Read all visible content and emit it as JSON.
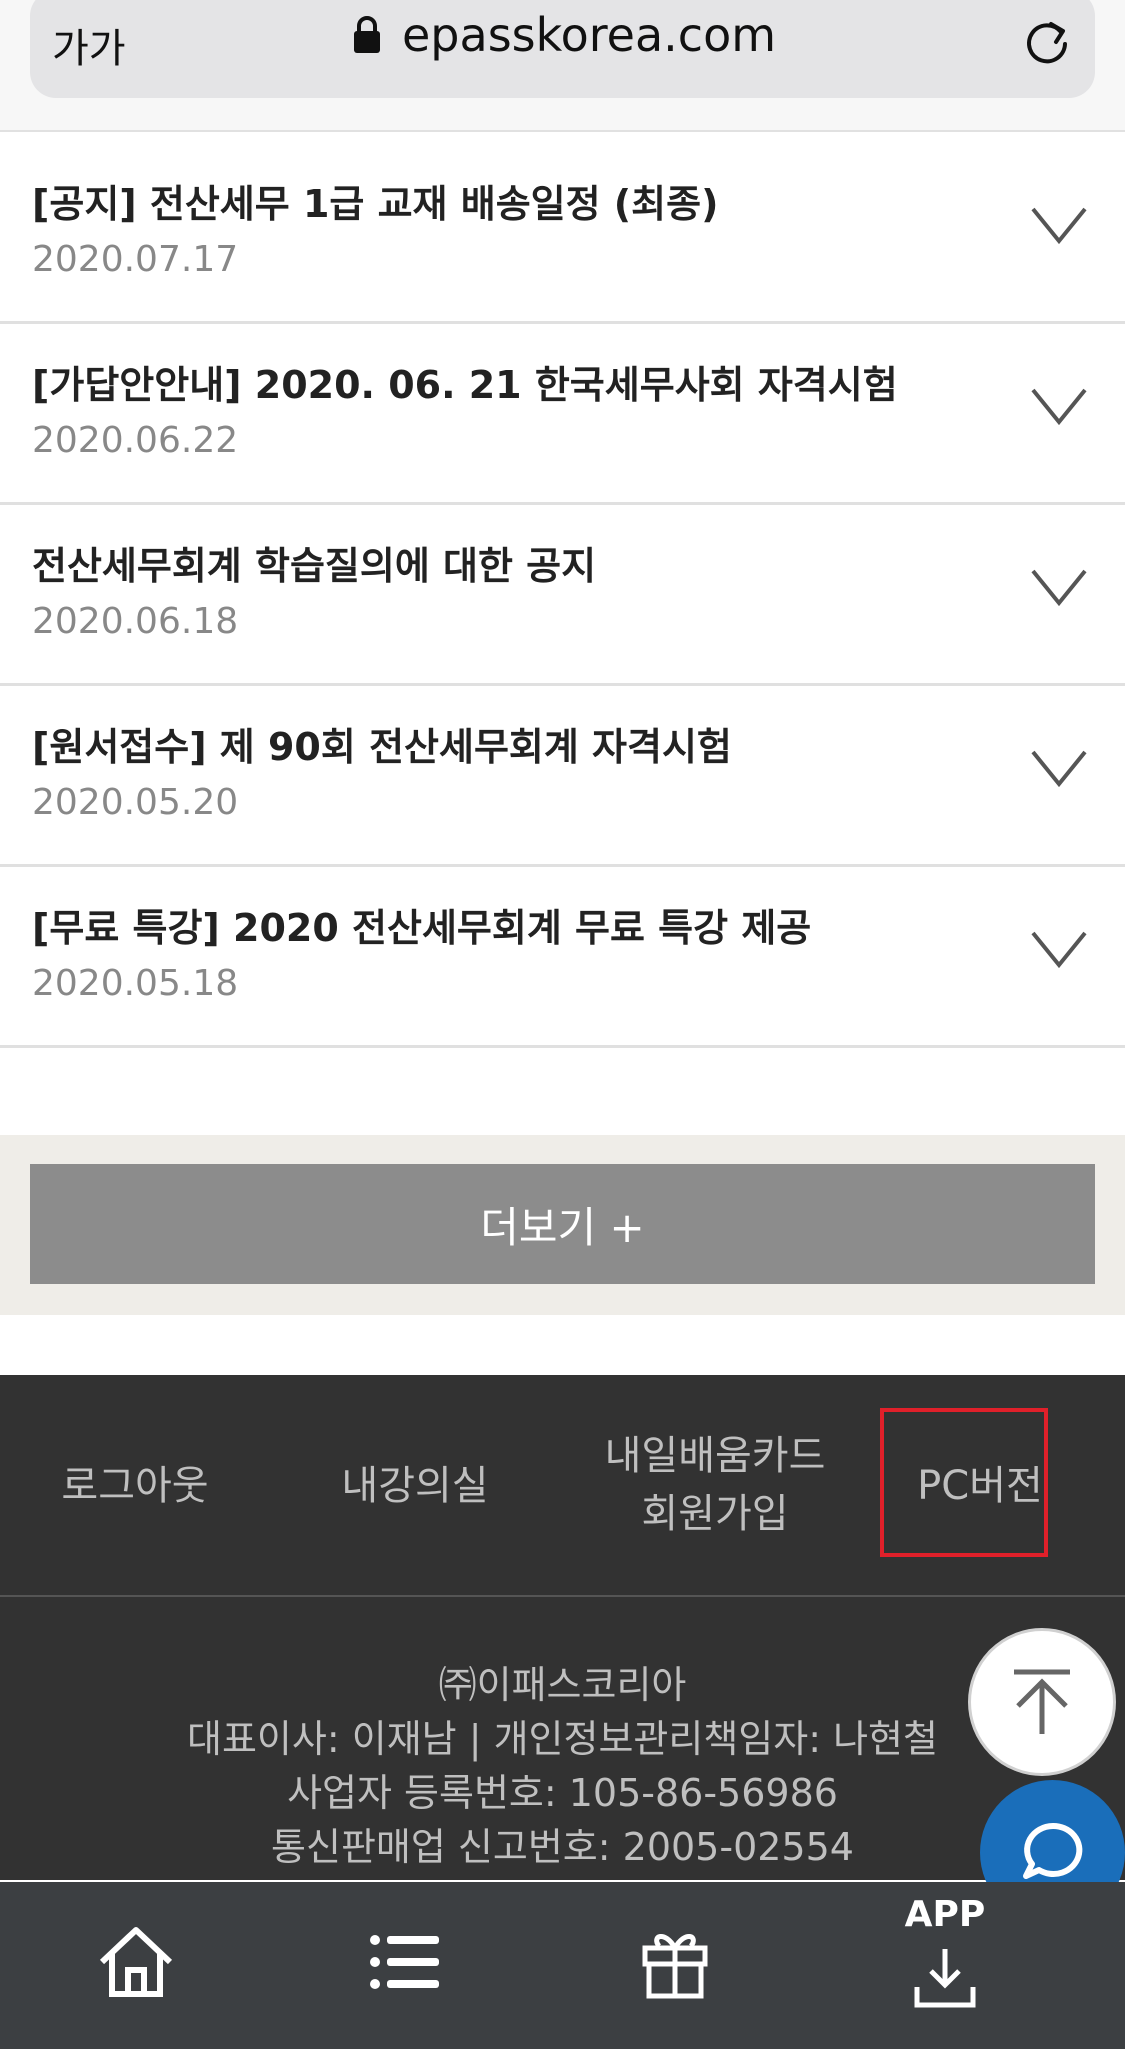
{
  "browser": {
    "text_size_label": "가가",
    "url": "epasskorea.com"
  },
  "notices": [
    {
      "title": "[공지] 전산세무 1급 교재 배송일정 (최종)",
      "date": "2020.07.17"
    },
    {
      "title": "[가답안안내] 2020. 06. 21 한국세무사회 자격시험",
      "date": "2020.06.22"
    },
    {
      "title": "전산세무회계 학습질의에 대한 공지",
      "date": "2020.06.18"
    },
    {
      "title": "[원서접수] 제 90회 전산세무회계 자격시험",
      "date": "2020.05.20"
    },
    {
      "title": "[무료 특강] 2020 전산세무회계 무료 특강 제공",
      "date": "2020.05.18"
    }
  ],
  "more_button": "더보기 +",
  "footer": {
    "logout": "로그아웃",
    "my_classroom": "내강의실",
    "card_signup_line1": "내일배움카드",
    "card_signup_line2": "회원가입",
    "pc_version": "PC버전",
    "company_name": "㈜이패스코리아",
    "representative": "대표이사: 이재남 | 개인정보관리책임자: 나현철",
    "business_reg": "사업자 등록번호: 105-86-56986",
    "mail_order_reg": "통신판매업 신고번호: 2005-02554"
  },
  "bottom_nav": {
    "app_label": "APP"
  },
  "colors": {
    "highlight_box": "#e0202a",
    "chat_button": "#1a6eba",
    "footer_bg": "#323232",
    "more_button_bg": "#8c8c8c"
  },
  "icons": {
    "chevron": "chevron-down-icon",
    "top": "arrow-up-icon",
    "chat": "chat-bubble-icon",
    "home": "home-icon",
    "menu": "list-menu-icon",
    "gift": "gift-icon",
    "app": "app-download-icon"
  }
}
